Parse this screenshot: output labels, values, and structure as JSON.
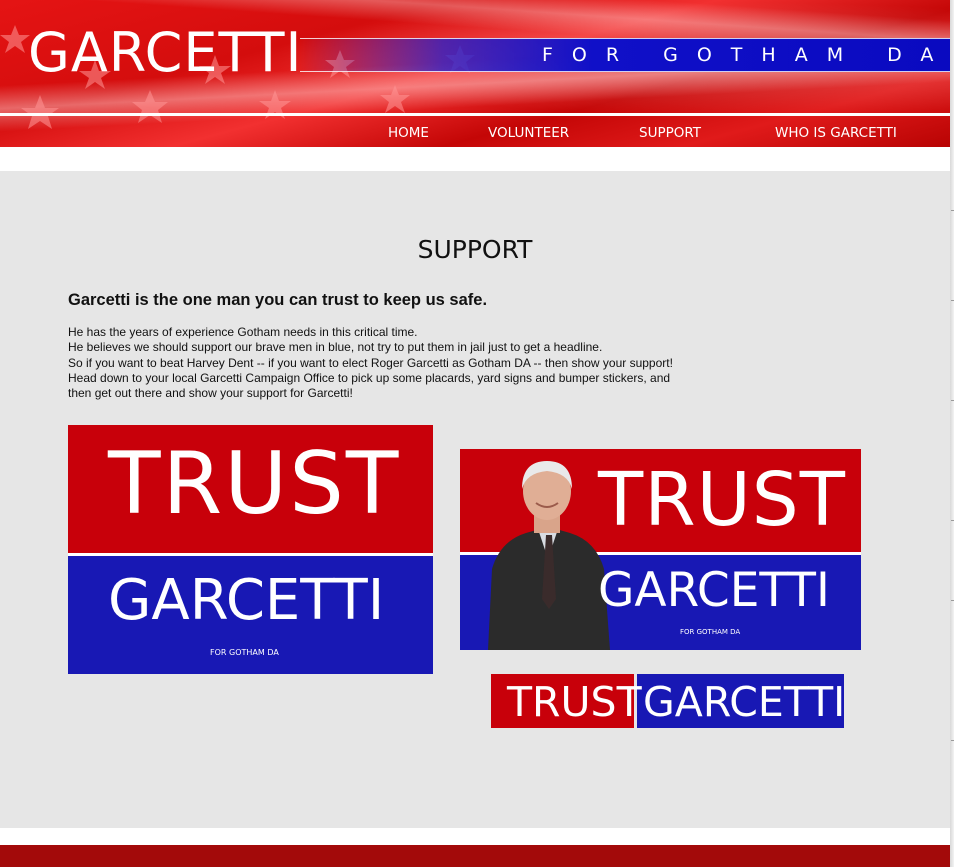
{
  "header": {
    "logo": "GARCETTI",
    "slogan": "FOR GOTHAM DA",
    "nav": [
      {
        "label": "HOME"
      },
      {
        "label": "VOLUNTEER"
      },
      {
        "label": "SUPPORT"
      },
      {
        "label": "WHO IS GARCETTI"
      }
    ]
  },
  "main": {
    "title": "SUPPORT",
    "headline": "Garcetti is the one man you can trust to keep us safe.",
    "body_lines": [
      "He has the years of experience Gotham needs in this critical time.",
      "He believes we should support our brave men in blue, not try to put them in jail just to get a headline.",
      "So if you want to beat Harvey Dent -- if you want to elect Roger Garcetti as Gotham DA -- then show your support!",
      "Head down to your local Garcetti Campaign Office to pick up some placards, yard signs and bumper stickers, and",
      "then get out there and show your support for Garcetti!"
    ]
  },
  "signs": {
    "placard": {
      "top": "TRUST",
      "bottom": "GARCETTI",
      "small": "FOR GOTHAM DA"
    },
    "yard_sign": {
      "top": "TRUST",
      "bottom": "GARCETTI",
      "small": "FOR GOTHAM DA"
    },
    "bumper_sticker": {
      "left": "TRUST",
      "right": "GARCETTI"
    }
  },
  "colors": {
    "sign_red": "#c8000a",
    "sign_blue": "#1818b4",
    "content_bg": "#e6e6e6",
    "footer": "#a30a0a"
  }
}
